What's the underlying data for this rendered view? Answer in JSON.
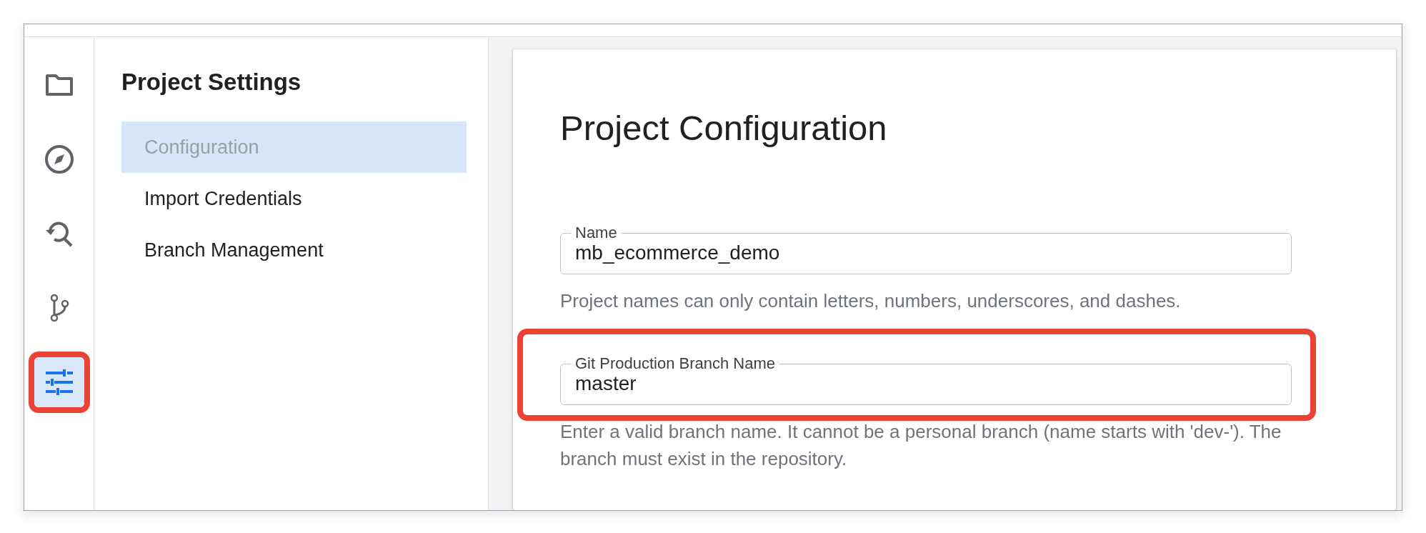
{
  "rail": [
    {
      "kind": "folder",
      "selected": false,
      "highlighted": false
    },
    {
      "kind": "compass",
      "selected": false,
      "highlighted": false
    },
    {
      "kind": "history",
      "selected": false,
      "highlighted": false
    },
    {
      "kind": "branch",
      "selected": false,
      "highlighted": false
    },
    {
      "kind": "sliders",
      "selected": true,
      "highlighted": true
    }
  ],
  "sidebar": {
    "title": "Project Settings",
    "items": [
      {
        "label": "Configuration",
        "selected": true
      },
      {
        "label": "Import Credentials",
        "selected": false
      },
      {
        "label": "Branch Management",
        "selected": false
      }
    ]
  },
  "card": {
    "title": "Project Configuration",
    "fields": [
      {
        "label": "Name",
        "value": "mb_ecommerce_demo",
        "help": "Project names can only contain letters, numbers, underscores, and dashes.",
        "highlighted": false
      },
      {
        "label": "Git Production Branch Name",
        "value": "master",
        "help": "Enter a valid branch name. It cannot be a personal branch (name starts with 'dev-'). The branch must exist in the repository.",
        "highlighted": true
      }
    ]
  }
}
